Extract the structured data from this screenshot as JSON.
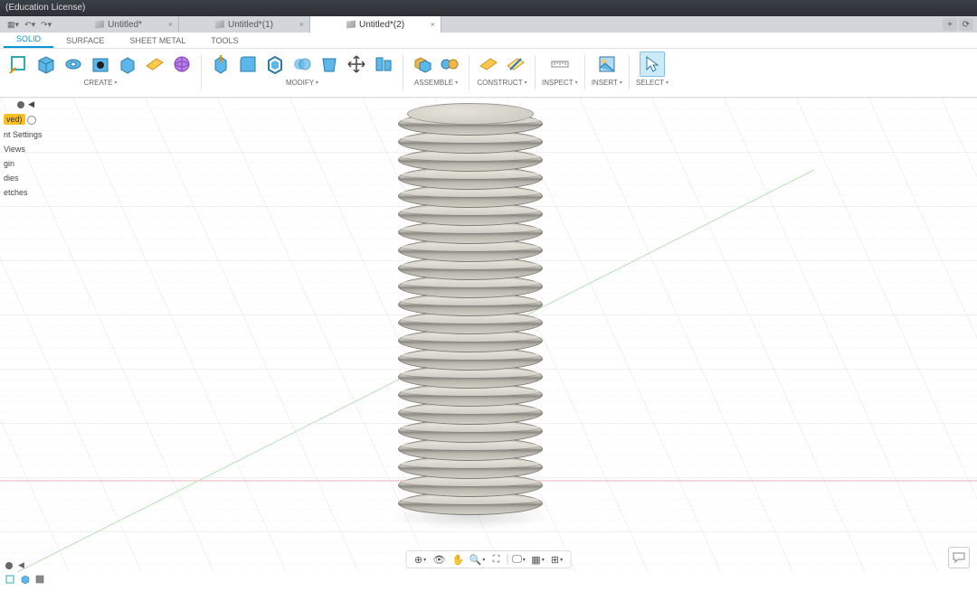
{
  "title": "(Education License)",
  "tabs": [
    {
      "label": "Untitled*"
    },
    {
      "label": "Untitled*(1)"
    },
    {
      "label": "Untitled*(2)"
    }
  ],
  "workspace_tabs": [
    {
      "label": "SOLID",
      "active": true
    },
    {
      "label": "SURFACE"
    },
    {
      "label": "SHEET METAL"
    },
    {
      "label": "TOOLS"
    }
  ],
  "toolbar_groups": {
    "create": "CREATE",
    "modify": "MODIFY",
    "assemble": "ASSEMBLE",
    "construct": "CONSTRUCT",
    "inspect": "INSPECT",
    "insert": "INSERT",
    "select": "SELECT"
  },
  "browser": {
    "saved": "ved)",
    "items": [
      "nt Settings",
      "Views",
      "gin",
      "dies",
      "etches"
    ]
  }
}
